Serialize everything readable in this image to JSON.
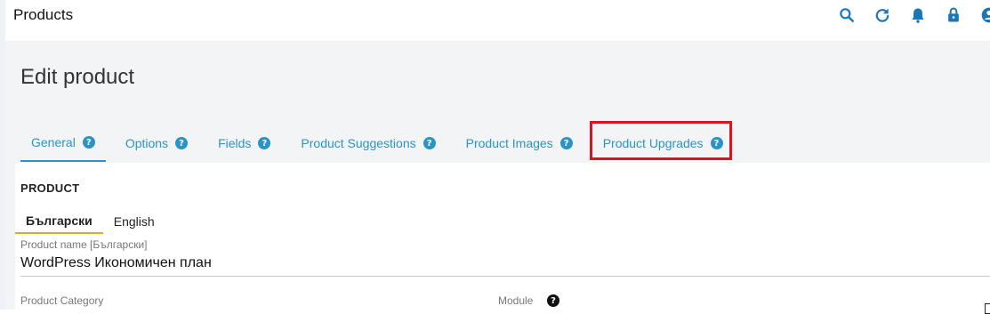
{
  "header": {
    "title": "Products",
    "icons": [
      "search-icon",
      "refresh-icon",
      "bell-icon",
      "lock-icon",
      "user-icon"
    ]
  },
  "page": {
    "title": "Edit product"
  },
  "tabs": [
    {
      "label": "General",
      "active": true
    },
    {
      "label": "Options",
      "active": false
    },
    {
      "label": "Fields",
      "active": false
    },
    {
      "label": "Product Suggestions",
      "active": false
    },
    {
      "label": "Product Images",
      "active": false
    },
    {
      "label": "Product Upgrades",
      "active": false,
      "highlighted": true
    }
  ],
  "help_glyph": "?",
  "section": {
    "label": "PRODUCT"
  },
  "languages": [
    {
      "label": "Български",
      "active": true
    },
    {
      "label": "English",
      "active": false
    }
  ],
  "fields": {
    "product_name_label": "Product name [Български]",
    "product_name_value": "WordPress Икономичен план",
    "category_label": "Product Category",
    "module_label": "Module"
  },
  "colors": {
    "accent": "#2a94c6",
    "highlight": "#e3101b",
    "lang_underline": "#e5a920"
  }
}
